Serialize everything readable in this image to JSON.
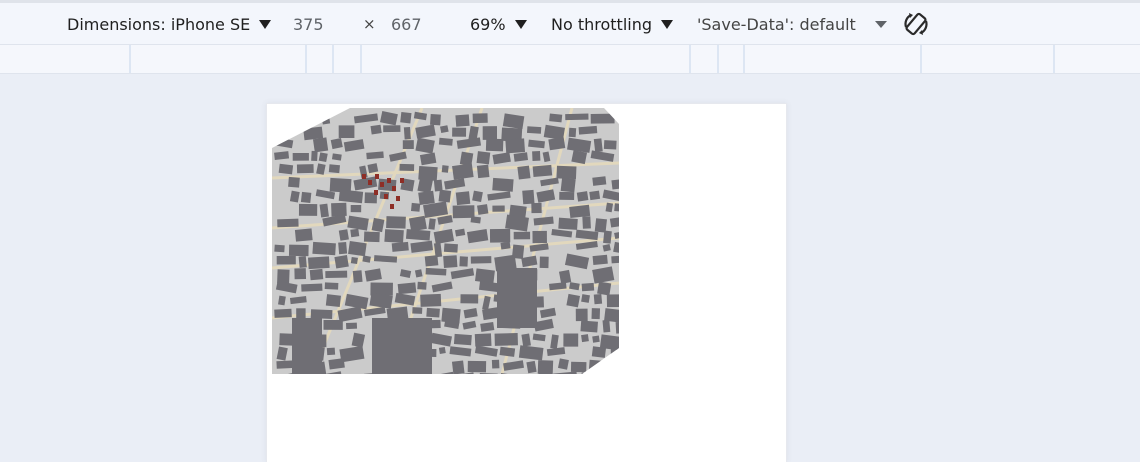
{
  "toolbar": {
    "dimensions_label": "Dimensions: iPhone SE",
    "width_value": "375",
    "times_symbol": "×",
    "height_value": "667",
    "zoom_label": "69%",
    "throttle_label": "No throttling",
    "save_data_label": "'Save-Data': default",
    "rotate_icon": "rotate-icon"
  },
  "colors": {
    "toolbar_bg": "#f3f6fc",
    "page_bg": "#eaeef6",
    "map_ground": "#cbcbcb",
    "building": "#6f6e74",
    "road": "#e2d8bd",
    "highlight": "#8e2e26"
  }
}
